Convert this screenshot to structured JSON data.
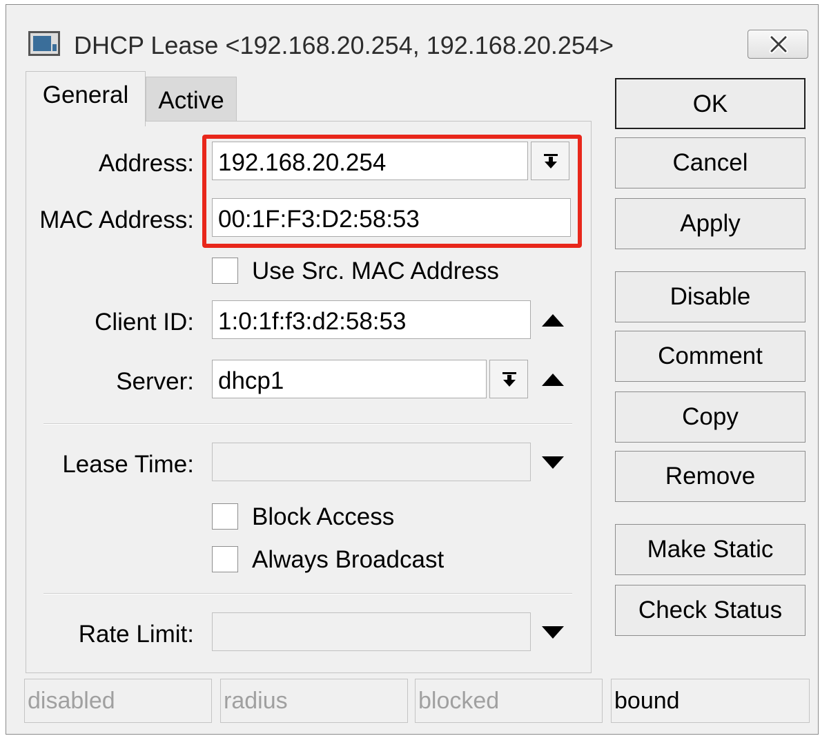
{
  "window": {
    "title": "DHCP Lease <192.168.20.254, 192.168.20.254>"
  },
  "tabs": [
    {
      "label": "General"
    },
    {
      "label": "Active"
    }
  ],
  "fields": {
    "address": {
      "label": "Address:",
      "value": "192.168.20.254"
    },
    "mac": {
      "label": "MAC Address:",
      "value": "00:1F:F3:D2:58:53"
    },
    "use_src_mac": {
      "label": "Use Src. MAC Address",
      "checked": false
    },
    "client_id": {
      "label": "Client ID:",
      "value": "1:0:1f:f3:d2:58:53"
    },
    "server": {
      "label": "Server:",
      "value": "dhcp1"
    },
    "lease_time": {
      "label": "Lease Time:",
      "value": ""
    },
    "block_access": {
      "label": "Block Access",
      "checked": false
    },
    "always_broadcast": {
      "label": "Always Broadcast",
      "checked": false
    },
    "rate_limit": {
      "label": "Rate Limit:",
      "value": ""
    }
  },
  "buttons": {
    "ok": "OK",
    "cancel": "Cancel",
    "apply": "Apply",
    "disable": "Disable",
    "comment": "Comment",
    "copy": "Copy",
    "remove": "Remove",
    "make_static": "Make Static",
    "check_status": "Check Status"
  },
  "status": {
    "disabled": "disabled",
    "radius": "radius",
    "blocked": "blocked",
    "bound": "bound"
  },
  "colors": {
    "highlight": "#e8271b",
    "window_bg": "#f0f0f0"
  },
  "icons": {
    "window": "winbox-window-icon",
    "close": "close-x-icon",
    "dropdown": "dropdown-arrow-icon",
    "expand_up": "up-triangle-icon",
    "expand_down": "down-triangle-icon"
  }
}
